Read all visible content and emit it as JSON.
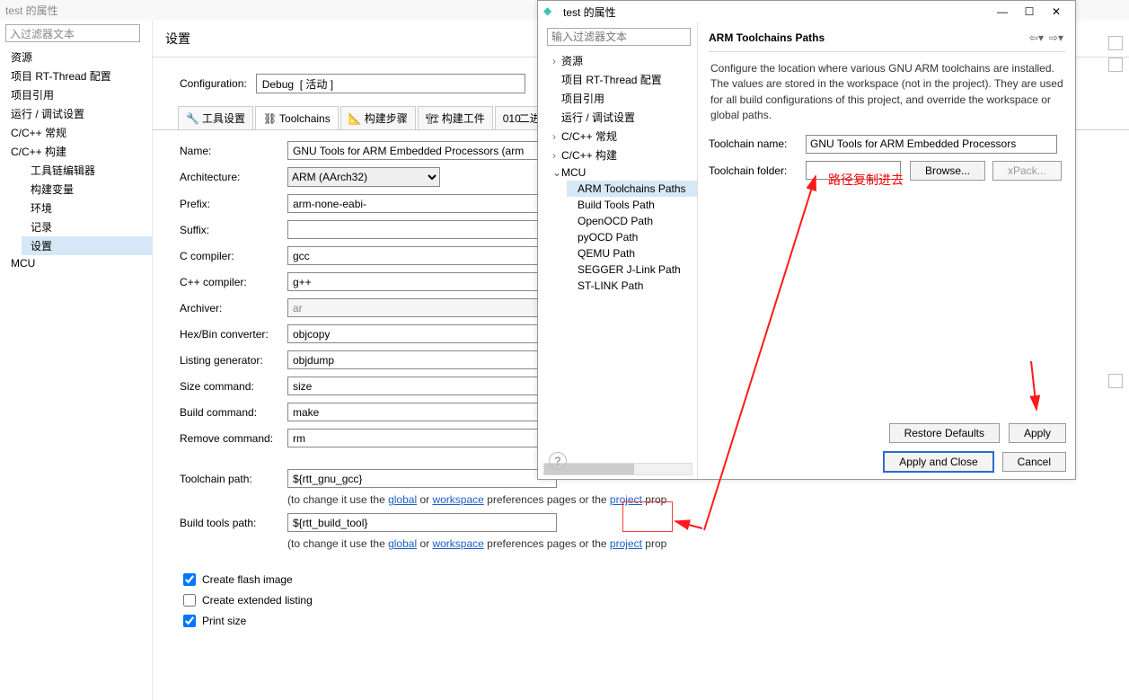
{
  "back_window": {
    "title": "test 的属性",
    "filter_placeholder": "入过滤器文本",
    "tree": {
      "t0": "资源",
      "t1": "项目 RT-Thread 配置",
      "t2": "项目引用",
      "t3": "运行 / 调试设置",
      "t4": "C/C++ 常规",
      "t5": "C/C++ 构建",
      "t5_children": {
        "c0": "工具链编辑器",
        "c1": "构建变量",
        "c2": "环境",
        "c3": "记录",
        "c4": "设置"
      },
      "t6": "MCU"
    },
    "page_title": "设置",
    "config_label": "Configuration:",
    "config_value": "Debug  [ 活动 ]",
    "tabs": {
      "t0": "工具设置",
      "t1": "Toolchains",
      "t2": "构建步骤",
      "t3": "构建工件",
      "t4": "二进制解析器"
    },
    "form": {
      "name_lbl": "Name:",
      "name_val": "GNU Tools for ARM Embedded Processors (arm",
      "arch_lbl": "Architecture:",
      "arch_val": "ARM (AArch32)",
      "prefix_lbl": "Prefix:",
      "prefix_val": "arm-none-eabi-",
      "suffix_lbl": "Suffix:",
      "suffix_val": "",
      "cc_lbl": "C compiler:",
      "cc_val": "gcc",
      "cxx_lbl": "C++ compiler:",
      "cxx_val": "g++",
      "ar_lbl": "Archiver:",
      "ar_val": "ar",
      "hex_lbl": "Hex/Bin converter:",
      "hex_val": "objcopy",
      "lst_lbl": "Listing generator:",
      "lst_val": "objdump",
      "size_lbl": "Size command:",
      "size_val": "size",
      "build_lbl": "Build command:",
      "build_val": "make",
      "rm_lbl": "Remove command:",
      "rm_val": "rm",
      "tcpath_lbl": "Toolchain path:",
      "tcpath_val": "${rtt_gnu_gcc}",
      "btpath_lbl": "Build tools path:",
      "btpath_val": "${rtt_build_tool}",
      "hint_prefix": "(to change it use the ",
      "hint_global": "global",
      "hint_or": " or ",
      "hint_workspace": "workspace",
      "hint_mid": " preferences pages or the ",
      "hint_project": "project",
      "hint_suffix": " prop",
      "cb0": "Create flash image",
      "cb1": "Create extended listing",
      "cb2": "Print size"
    }
  },
  "dialog2": {
    "title": "test 的属性",
    "filter_placeholder": "输入过滤器文本",
    "tree": {
      "t0": "资源",
      "t1": "项目 RT-Thread 配置",
      "t2": "项目引用",
      "t3": "运行 / 调试设置",
      "t4": "C/C++ 常规",
      "t5": "C/C++ 构建",
      "t6": "MCU",
      "mcu_children": {
        "c0": "ARM Toolchains Paths",
        "c1": "Build Tools Path",
        "c2": "OpenOCD Path",
        "c3": "pyOCD Path",
        "c4": "QEMU Path",
        "c5": "SEGGER J-Link Path",
        "c6": "ST-LINK Path"
      }
    },
    "page_title": "ARM Toolchains Paths",
    "desc": "Configure the location where various GNU ARM toolchains are installed. The values are stored in the workspace (not in the project). They are used for all build configurations of this project, and override the workspace or global paths.",
    "tc_name_lbl": "Toolchain name:",
    "tc_name_val": "GNU Tools for ARM Embedded Processors",
    "tc_folder_lbl": "Toolchain folder:",
    "tc_folder_val": "",
    "browse_btn": "Browse...",
    "xpack_btn": "xPack...",
    "restore_btn": "Restore Defaults",
    "apply_btn": "Apply",
    "apply_close_btn": "Apply and Close",
    "cancel_btn": "Cancel"
  },
  "annotation": {
    "red_text": "路径复制进去"
  }
}
